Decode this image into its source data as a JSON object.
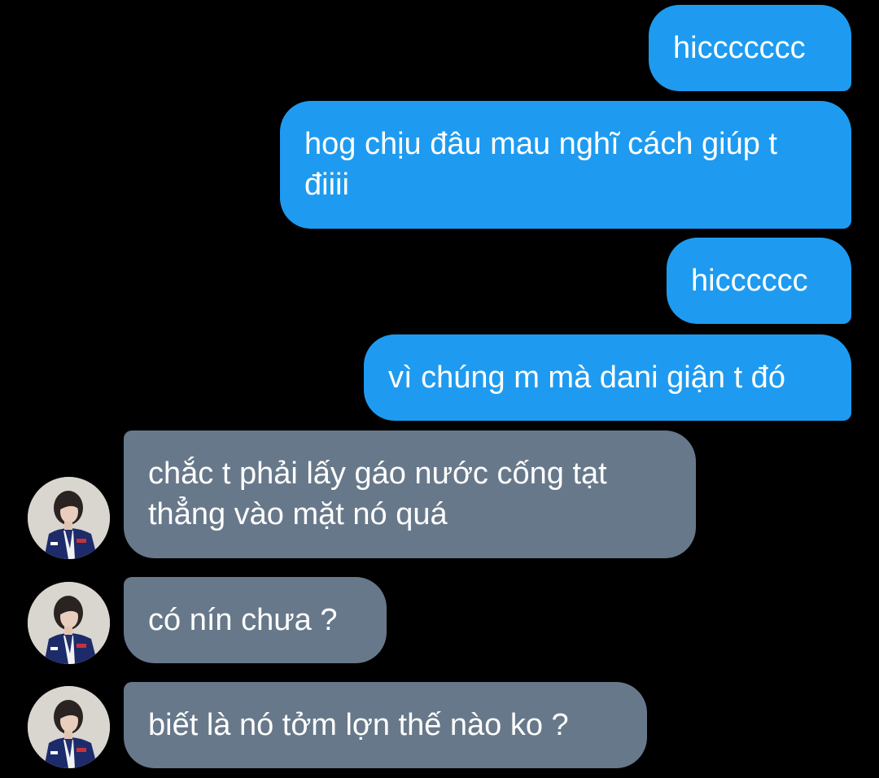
{
  "chat": {
    "messages": [
      {
        "direction": "outgoing",
        "text": "hiccccccc"
      },
      {
        "direction": "outgoing",
        "text": "hog chịu đâu mau nghĩ cách giúp t điiii"
      },
      {
        "direction": "outgoing",
        "text": "hicccccc"
      },
      {
        "direction": "outgoing",
        "text": "vì chúng m mà dani giận t đó"
      },
      {
        "direction": "incoming",
        "text": "chắc t phải lấy gáo nước cống tạt thẳng vào mặt nó quá"
      },
      {
        "direction": "incoming",
        "text": "có nín chưa ?"
      },
      {
        "direction": "incoming",
        "text": "biết là nó tởm lợn thế nào ko ?"
      }
    ]
  },
  "colors": {
    "background": "#000000",
    "outgoing_bubble": "#1e9bf0",
    "incoming_bubble": "#67788a",
    "text": "#ffffff"
  },
  "icons": {
    "avatar": "contact-avatar-photo"
  }
}
